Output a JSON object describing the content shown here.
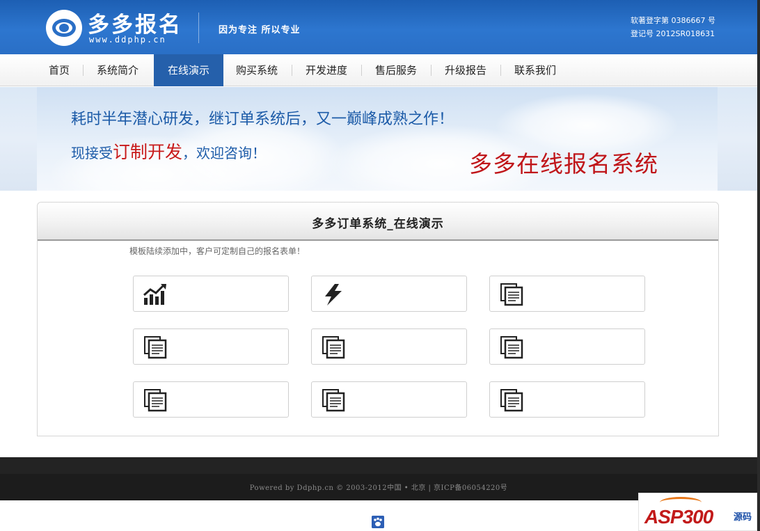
{
  "header": {
    "brand_name": "多多报名",
    "brand_url": "www.ddphp.cn",
    "slogan": "因为专注  所以专业",
    "software_copyright": "软著登字第 0386667 号",
    "registration_no": "登记号 2012SR018631"
  },
  "nav": {
    "items": [
      {
        "label": "首页",
        "active": false
      },
      {
        "label": "系统简介",
        "active": false
      },
      {
        "label": "在线演示",
        "active": true
      },
      {
        "label": "购买系统",
        "active": false
      },
      {
        "label": "开发进度",
        "active": false
      },
      {
        "label": "售后服务",
        "active": false
      },
      {
        "label": "升级报告",
        "active": false
      },
      {
        "label": "联系我们",
        "active": false
      }
    ]
  },
  "banner": {
    "line1": "耗时半年潜心研发，继订单系统后，又一巅峰成熟之作！",
    "line2_prefix": "现接受",
    "line2_highlight": "订制开发",
    "line2_suffix": "，欢迎咨询！",
    "product_name": "多多在线报名系统"
  },
  "panel": {
    "title": "多多订单系统_在线演示",
    "note": "模板陆续添加中，客户可定制自己的报名表单！",
    "tiles": [
      {
        "icon": "bar-chart-growth-icon"
      },
      {
        "icon": "lightning-icon"
      },
      {
        "icon": "document-copy-icon"
      },
      {
        "icon": "document-copy-icon"
      },
      {
        "icon": "document-copy-icon"
      },
      {
        "icon": "document-copy-icon"
      },
      {
        "icon": "document-copy-icon"
      },
      {
        "icon": "document-copy-icon"
      },
      {
        "icon": "document-copy-icon"
      }
    ]
  },
  "footer": {
    "text": "Powered by Ddphp.cn © 2003-2012中国 • 北京  | 京ICP备06054220号",
    "badge_icon": "paw-icon"
  },
  "watermark": {
    "text": "ASP300",
    "suffix": "源码"
  },
  "colors": {
    "header_blue": "#2a6fc6",
    "nav_active": "#2560ab",
    "banner_text_blue": "#1c5ba8",
    "banner_red": "#c0161a",
    "footer_dark": "#1c1c1c"
  }
}
